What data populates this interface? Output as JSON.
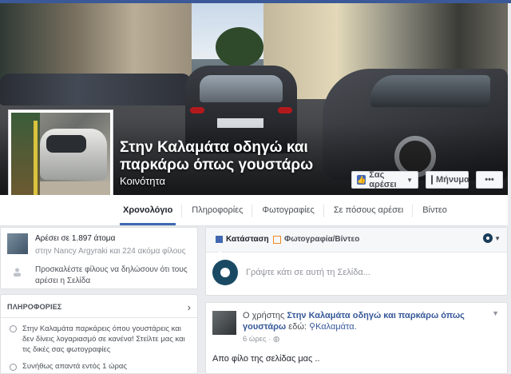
{
  "page": {
    "title": "Στην Καλαμάτα οδηγώ και παρκάρω όπως γουστάρω",
    "category": "Κοινότητα"
  },
  "cover_buttons": {
    "like": "Σας αρέσει",
    "message": "Μήνυμα",
    "more": "•••"
  },
  "tabs": [
    {
      "label": "Χρονολόγιο",
      "active": true
    },
    {
      "label": "Πληροφορίες"
    },
    {
      "label": "Φωτογραφίες"
    },
    {
      "label": "Σε πόσους αρέσει"
    },
    {
      "label": "Βίντεο"
    }
  ],
  "likes": {
    "count_text": "Αρέσει σε 1.897 άτομα",
    "friends_text": "στην Nancy Argyraki και 224 ακόμα φίλους",
    "invite_text": "Προσκαλέστε φίλους να δηλώσουν ότι τους αρέσει η Σελίδα"
  },
  "info": {
    "header": "ΠΛΗΡΟΦΟΡΙΕΣ",
    "about": "Στην Καλαμάτα παρκάρεις όπου γουστάρεις και δεν δίνεις λογαριασμό σε κανένα! Στείλτε μας και τις δικές σας φωτογραφίες",
    "more": "Συνήθως απαντά εντός 1 ώρας"
  },
  "composer": {
    "status_label": "Κατάσταση",
    "photo_label": "Φωτογραφία/Βίντεο",
    "placeholder": "Γράψτε κάτι σε αυτή τη Σελίδα..."
  },
  "post": {
    "prefix": "Ο χρήστης",
    "author": "Στην Καλαμάτα οδηγώ και παρκάρω όπως γουστάρω",
    "location_prefix": "εδώ:",
    "location": "Καλαμάτα.",
    "time": "6 ώρες",
    "body": "Απο φίλο της σελίδας μας .."
  },
  "colors": {
    "brand": "#3b5998",
    "link": "#365899",
    "tab_active": "#4267b2"
  }
}
